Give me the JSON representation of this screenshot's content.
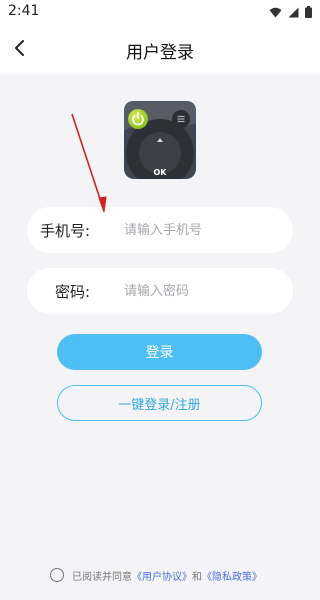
{
  "status_bar": {
    "time": "2:41"
  },
  "header": {
    "title": "用户登录"
  },
  "form": {
    "phone_label": "手机号:",
    "phone_placeholder": "请输入手机号",
    "password_label": "密码:",
    "password_placeholder": "请输入密码"
  },
  "buttons": {
    "login": "登录",
    "quick_login": "一键登录/注册"
  },
  "agreement": {
    "prefix": "已阅读并同意",
    "user_agreement": "《用户协议》",
    "connector": "和",
    "privacy_policy": "《隐私政策》"
  },
  "colors": {
    "accent": "#4dbff2",
    "link": "#4a72d6",
    "annotation_arrow": "#d62020"
  }
}
